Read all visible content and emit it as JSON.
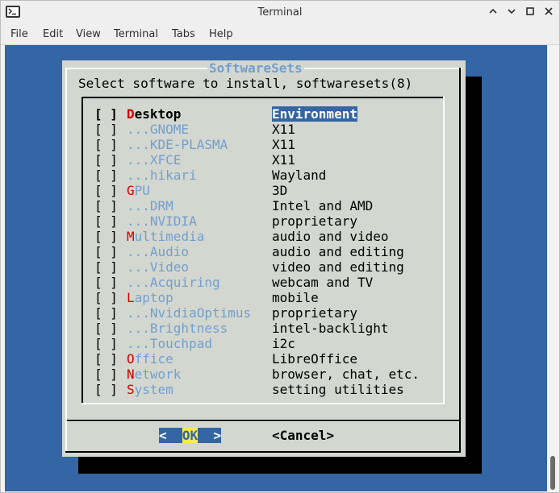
{
  "window": {
    "title": "Terminal",
    "controls": {
      "minimize": "⌃",
      "maximize": "□",
      "close": "✕"
    }
  },
  "menubar": [
    "File",
    "Edit",
    "View",
    "Terminal",
    "Tabs",
    "Help"
  ],
  "dialog": {
    "title": "SoftwareSets",
    "prompt": "Select software to install, softwaresets(8)",
    "items": [
      {
        "check": "[ ]",
        "hot": "D",
        "rest": "esktop",
        "desc": "Environment",
        "selected": true
      },
      {
        "check": "[ ]",
        "hot": "",
        "rest": "...GNOME",
        "desc": "X11"
      },
      {
        "check": "[ ]",
        "hot": "",
        "rest": "...KDE-PLASMA",
        "desc": "X11"
      },
      {
        "check": "[ ]",
        "hot": "",
        "rest": "...XFCE",
        "desc": "X11"
      },
      {
        "check": "[ ]",
        "hot": "",
        "rest": "...hikari",
        "desc": "Wayland"
      },
      {
        "check": "[ ]",
        "hot": "G",
        "rest": "PU",
        "desc": "3D"
      },
      {
        "check": "[ ]",
        "hot": "",
        "rest": "...DRM",
        "desc": "Intel and AMD"
      },
      {
        "check": "[ ]",
        "hot": "",
        "rest": "...NVIDIA",
        "desc": "proprietary"
      },
      {
        "check": "[ ]",
        "hot": "M",
        "rest": "ultimedia",
        "desc": "audio and video"
      },
      {
        "check": "[ ]",
        "hot": "",
        "rest": "...Audio",
        "desc": "audio and editing"
      },
      {
        "check": "[ ]",
        "hot": "",
        "rest": "...Video",
        "desc": "video and editing"
      },
      {
        "check": "[ ]",
        "hot": "",
        "rest": "...Acquiring",
        "desc": "webcam and TV"
      },
      {
        "check": "[ ]",
        "hot": "L",
        "rest": "aptop",
        "desc": "mobile"
      },
      {
        "check": "[ ]",
        "hot": "",
        "rest": "...NvidiaOptimus",
        "desc": "proprietary"
      },
      {
        "check": "[ ]",
        "hot": "",
        "rest": "...Brightness",
        "desc": "intel-backlight"
      },
      {
        "check": "[ ]",
        "hot": "",
        "rest": "...Touchpad",
        "desc": "i2c"
      },
      {
        "check": "[ ]",
        "hot": "O",
        "rest": "ffice",
        "desc": "LibreOffice"
      },
      {
        "check": "[ ]",
        "hot": "N",
        "rest": "etwork",
        "desc": "browser, chat, etc."
      },
      {
        "check": "[ ]",
        "hot": "S",
        "rest": "ystem",
        "desc": "setting utilities"
      }
    ],
    "ok": {
      "left": "<  ",
      "hot": "OK",
      "right": "  >"
    },
    "cancel": "<Cancel>"
  }
}
